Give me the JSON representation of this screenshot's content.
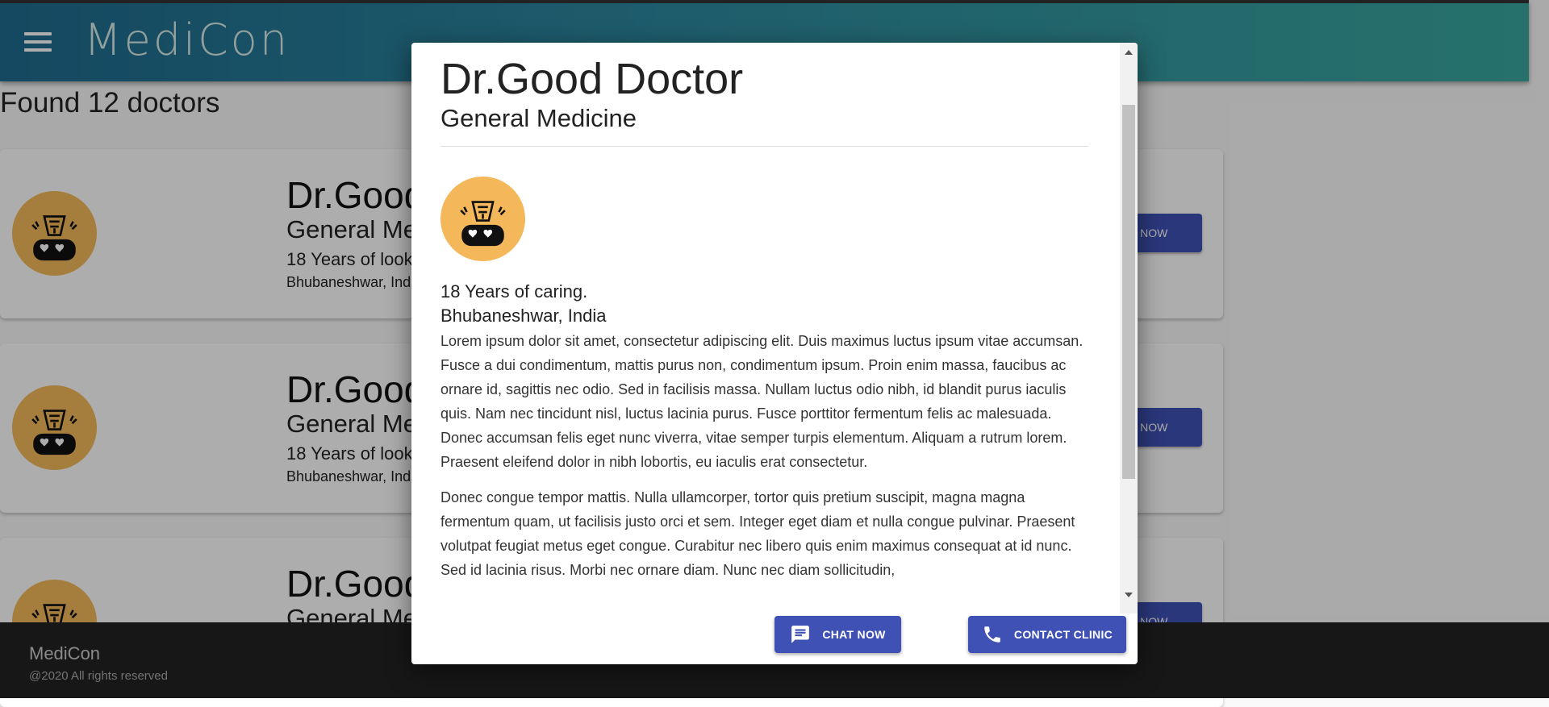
{
  "header": {
    "app_name": "MediCon"
  },
  "results": {
    "heading": "Found 12 doctors"
  },
  "cards": [
    {
      "name": "Dr.Good",
      "specialty": "General Me",
      "years": "18 Years of look",
      "location": "Bhubaneshwar, Ind",
      "button": "AT NOW"
    },
    {
      "name": "Dr.Good",
      "specialty": "General Me",
      "years": "18 Years of look",
      "location": "Bhubaneshwar, Ind",
      "button": "AT NOW"
    },
    {
      "name": "Dr.Good",
      "specialty": "General Me",
      "button": "AT NOW"
    }
  ],
  "footer": {
    "app_name": "MediCon",
    "copyright": "@2020 All rights reserved"
  },
  "modal": {
    "title": "Dr.Good Doctor",
    "specialty": "General Medicine",
    "years": "18 Years of caring.",
    "location": "Bhubaneshwar, India",
    "paragraphs": [
      "Lorem ipsum dolor sit amet, consectetur adipiscing elit. Duis maximus luctus ipsum vitae accumsan. Fusce a dui condimentum, mattis purus non, condimentum ipsum. Proin enim massa, faucibus ac ornare id, sagittis nec odio. Sed in facilisis massa. Nullam luctus odio nibh, id blandit purus iaculis quis. Nam nec tincidunt nisl, luctus lacinia purus. Fusce porttitor fermentum felis ac malesuada. Donec accumsan felis eget nunc viverra, vitae semper turpis elementum. Aliquam a rutrum lorem. Praesent eleifend dolor in nibh lobortis, eu iaculis erat consectetur.",
      "Donec congue tempor mattis. Nulla ullamcorper, tortor quis pretium suscipit, magna magna fermentum quam, ut facilisis justo orci et sem. Integer eget diam et nulla congue pulvinar. Praesent volutpat feugiat metus eget congue. Curabitur nec libero quis enim maximus consequat at id nunc. Sed id lacinia risus. Morbi nec ornare diam. Nunc nec diam sollicitudin,"
    ],
    "chat_button": "CHAT NOW",
    "contact_button": "CONTACT CLINIC"
  },
  "icons": {
    "menu": "menu-icon",
    "avatar": "doctor-avatar-icon",
    "chat": "chat-icon",
    "phone": "phone-icon"
  },
  "colors": {
    "primary": "#3f51b5",
    "header_start": "#1f6b8f",
    "header_end": "#3aa7a0",
    "avatar": "#f4b85a",
    "footer": "#222222"
  }
}
